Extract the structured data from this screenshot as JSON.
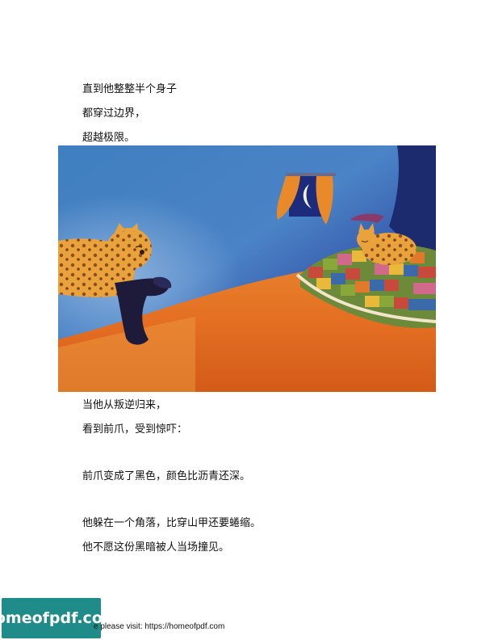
{
  "text_top": [
    "直到他整整半个身子",
    "都穿过边界，",
    "超越极限。"
  ],
  "text_bottom": [
    "当他从叛逆归来，",
    "看到前爪，受到惊吓：",
    "前爪变成了黑色，颜色比沥青还深。",
    "他躲在一个角落，比穿山甲还要蜷缩。",
    "他不愿这份黑暗被人当场撞见。"
  ],
  "watermark": {
    "badge_text": "homeofpdf.com",
    "footer_text": "e please visit: https://homeofpdf.com"
  }
}
